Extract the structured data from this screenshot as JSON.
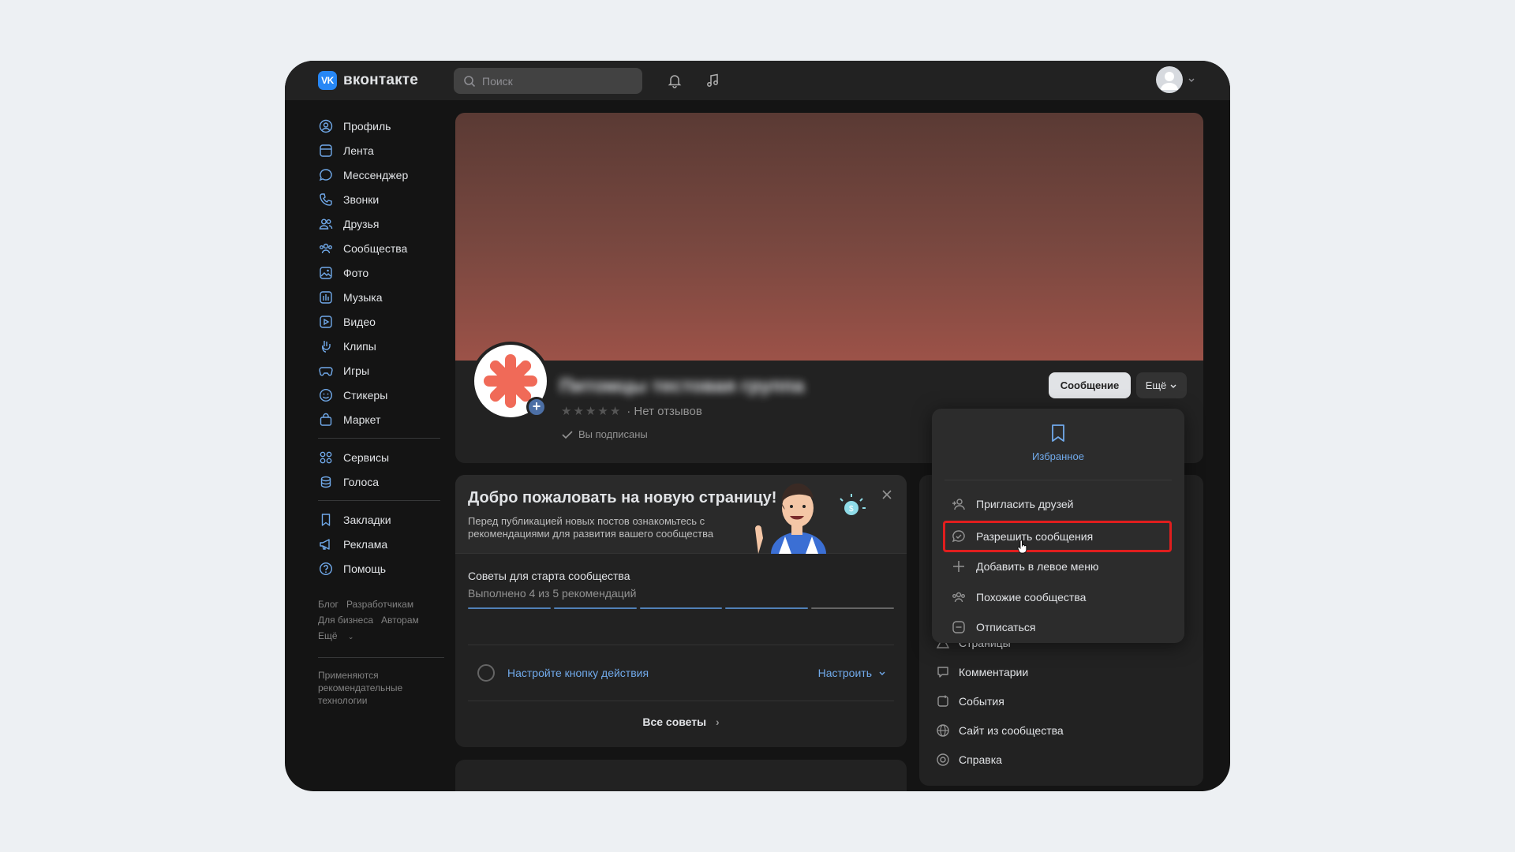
{
  "header": {
    "logo_mark": "VK",
    "logo_text": "вконтакте",
    "search_placeholder": "Поиск",
    "icons": [
      "bell-icon",
      "music-icon"
    ]
  },
  "sidebar": {
    "items": [
      {
        "label": "Профиль",
        "icon": "user-circle-icon"
      },
      {
        "label": "Лента",
        "icon": "newsfeed-icon"
      },
      {
        "label": "Мессенджер",
        "icon": "message-icon"
      },
      {
        "label": "Звонки",
        "icon": "phone-icon"
      },
      {
        "label": "Друзья",
        "icon": "friends-icon"
      },
      {
        "label": "Сообщества",
        "icon": "communities-icon"
      },
      {
        "label": "Фото",
        "icon": "photo-icon"
      },
      {
        "label": "Музыка",
        "icon": "music-icon"
      },
      {
        "label": "Видео",
        "icon": "video-icon"
      },
      {
        "label": "Клипы",
        "icon": "clips-icon"
      },
      {
        "label": "Игры",
        "icon": "gamepad-icon"
      },
      {
        "label": "Стикеры",
        "icon": "smile-icon"
      },
      {
        "label": "Маркет",
        "icon": "bag-icon"
      }
    ],
    "items2": [
      {
        "label": "Сервисы",
        "icon": "services-icon"
      },
      {
        "label": "Голоса",
        "icon": "coins-icon"
      }
    ],
    "items3": [
      {
        "label": "Закладки",
        "icon": "bookmark-icon"
      },
      {
        "label": "Реклама",
        "icon": "megaphone-icon"
      },
      {
        "label": "Помощь",
        "icon": "help-icon"
      }
    ],
    "footer_links": [
      "Блог",
      "Разработчикам",
      "Для бизнеса",
      "Авторам",
      "Ещё"
    ],
    "footer_note": "Применяются рекомендательные технологии"
  },
  "profile": {
    "group_name": "Питомцы тестовая группа",
    "rating_text": "· Нет отзывов",
    "subscribed": "Вы подписаны",
    "message_button": "Сообщение",
    "more_button": "Ещё"
  },
  "welcome": {
    "title": "Добро пожаловать на новую страницу!",
    "desc": "Перед публикацией новых постов ознакомьтесь с рекомендациями для развития вашего сообщества",
    "tips_title": "Советы для старта сообщества",
    "tips_sub": "Выполнено 4 из 5 рекомендаций",
    "progress_done": 4,
    "progress_total": 5,
    "action_label": "Настройте кнопку действия",
    "action_button": "Настроить",
    "all_tips": "Все советы"
  },
  "right_menu": {
    "items": [
      "Страницы",
      "Комментарии",
      "События",
      "Сайт из сообщества",
      "Справка"
    ]
  },
  "dropdown": {
    "favorite": "Избранное",
    "items": [
      "Пригласить друзей",
      "Разрешить сообщения",
      "Добавить в левое меню",
      "Похожие сообщества",
      "Отписаться"
    ],
    "highlighted_index": 1
  },
  "colors": {
    "accent": "#71aaeb",
    "highlight_border": "#e01e1e",
    "logo_blue": "#2787f5",
    "avatar_logo": "#f06a58"
  }
}
